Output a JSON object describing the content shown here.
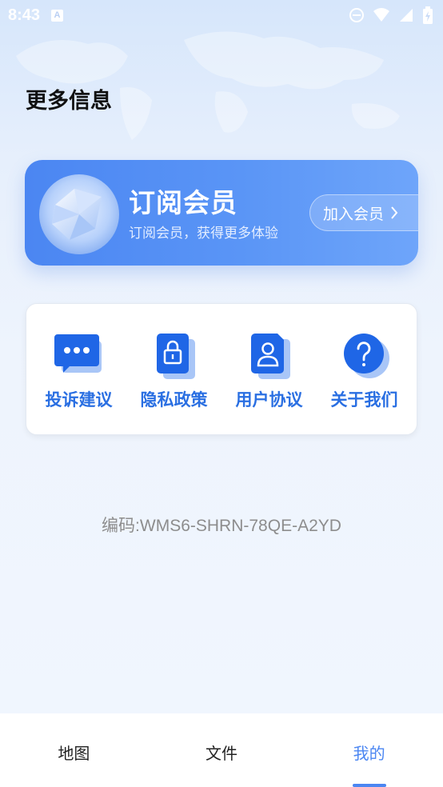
{
  "status_bar": {
    "time": "8:43",
    "notification_icon": "a-icon",
    "icons": [
      "do-not-disturb-icon",
      "wifi-icon",
      "signal-icon",
      "battery-icon"
    ]
  },
  "page": {
    "title": "更多信息"
  },
  "member_card": {
    "title": "订阅会员",
    "subtitle": "订阅会员，获得更多体验",
    "join_label": "加入会员",
    "icon": "diamond-icon"
  },
  "quick_links": [
    {
      "label": "投诉建议",
      "icon": "chat-bubble-icon"
    },
    {
      "label": "隐私政策",
      "icon": "lock-icon"
    },
    {
      "label": "用户协议",
      "icon": "user-document-icon"
    },
    {
      "label": "关于我们",
      "icon": "question-icon"
    }
  ],
  "device_code": "编码:WMS6-SHRN-78QE-A2YD",
  "bottom_nav": {
    "tabs": [
      {
        "label": "地图",
        "active": false
      },
      {
        "label": "文件",
        "active": false
      },
      {
        "label": "我的",
        "active": true
      }
    ]
  },
  "colors": {
    "accent": "#4b86f2",
    "link_text": "#2a6fe2",
    "icon_blue": "#1f66e6",
    "icon_shadow": "#a9c6f7"
  }
}
